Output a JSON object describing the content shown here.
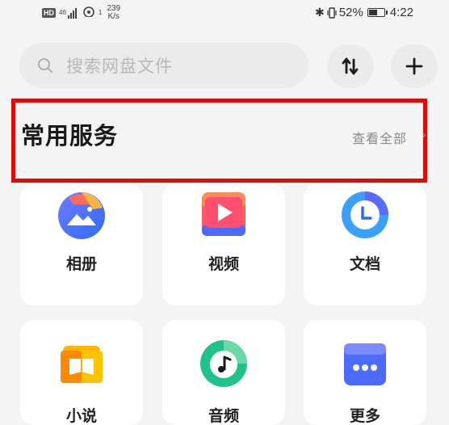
{
  "status_bar": {
    "hd": "HD",
    "network": "46",
    "speed_value": "239",
    "speed_unit": "K/s",
    "wifi_sup": "1",
    "battery": "52%",
    "battery_level": 0.52,
    "time": "4:22"
  },
  "search": {
    "placeholder": "搜索网盘文件"
  },
  "toolbar": {
    "sort_icon": "sort-arrows-icon",
    "add_icon": "plus-icon"
  },
  "section": {
    "title": "常用服务",
    "see_all": "查看全部",
    "arrow": "›"
  },
  "services": [
    {
      "label": "相册",
      "icon": "album-icon"
    },
    {
      "label": "视频",
      "icon": "video-icon"
    },
    {
      "label": "文档",
      "icon": "document-icon"
    },
    {
      "label": "小说",
      "icon": "novel-icon"
    },
    {
      "label": "音频",
      "icon": "audio-icon"
    },
    {
      "label": "更多",
      "icon": "more-icon"
    }
  ],
  "colors": {
    "highlight_border": "#e10a0a",
    "background": "#f4f4f4",
    "card": "#ffffff"
  }
}
